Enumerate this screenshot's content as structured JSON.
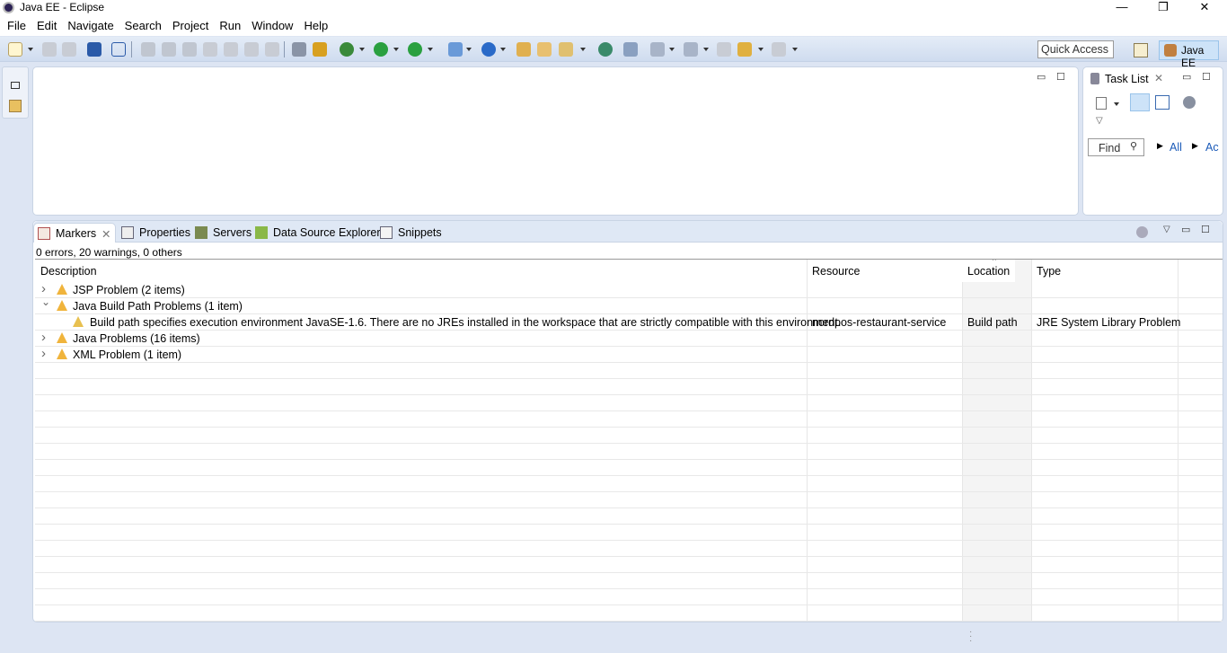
{
  "window": {
    "title": "Java EE - Eclipse",
    "minimize": "—",
    "restore": "❐",
    "close": "✕"
  },
  "menu": [
    "File",
    "Edit",
    "Navigate",
    "Search",
    "Project",
    "Run",
    "Window",
    "Help"
  ],
  "toolbar": {
    "quick_access_placeholder": "Quick Access",
    "perspective": "Java EE"
  },
  "task_list": {
    "title": "Task List",
    "find_placeholder": "Find",
    "filter_all": "All",
    "filter_ac": "Ac"
  },
  "bottom": {
    "tabs": [
      {
        "label": "Markers",
        "active": true
      },
      {
        "label": "Properties"
      },
      {
        "label": "Servers"
      },
      {
        "label": "Data Source Explorer"
      },
      {
        "label": "Snippets"
      }
    ],
    "status": "0 errors, 20 warnings, 0 others",
    "columns": [
      "Description",
      "Resource",
      "Location",
      "Type"
    ],
    "rows": [
      {
        "expander": "collapsed",
        "description": "JSP Problem (2 items)",
        "resource": "",
        "location": "",
        "type": ""
      },
      {
        "expander": "expanded",
        "description": "Java Build Path Problems (1 item)",
        "resource": "",
        "location": "",
        "type": ""
      },
      {
        "expander": "none",
        "description": "Build path specifies execution environment JavaSE-1.6. There are no JREs installed in the workspace that are strictly compatible with this environment.",
        "resource": "nordpos-restaurant-service",
        "location": "Build path",
        "type": "JRE System Library Problem"
      },
      {
        "expander": "collapsed",
        "description": "Java Problems (16 items)",
        "resource": "",
        "location": "",
        "type": ""
      },
      {
        "expander": "collapsed",
        "description": "XML Problem (1 item)",
        "resource": "",
        "location": "",
        "type": ""
      }
    ]
  },
  "colors": {
    "warning": "#f0b43c",
    "background": "#dde5f3",
    "perspective_active": "#cde3f8"
  }
}
